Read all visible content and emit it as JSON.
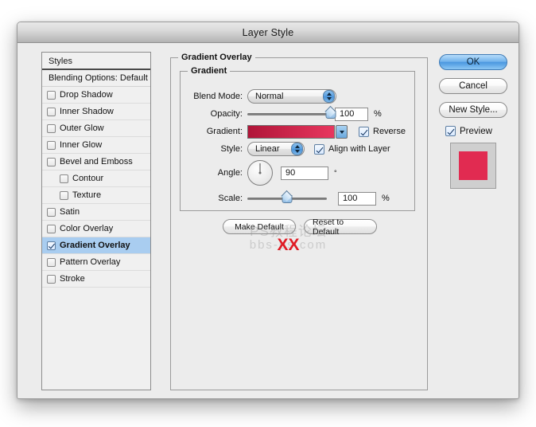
{
  "window": {
    "title": "Layer Style"
  },
  "styles_panel": {
    "header": "Styles",
    "blending_options": "Blending Options: Default",
    "items": [
      {
        "label": "Drop Shadow",
        "checked": false,
        "indent": false,
        "selected": false
      },
      {
        "label": "Inner Shadow",
        "checked": false,
        "indent": false,
        "selected": false
      },
      {
        "label": "Outer Glow",
        "checked": false,
        "indent": false,
        "selected": false
      },
      {
        "label": "Inner Glow",
        "checked": false,
        "indent": false,
        "selected": false
      },
      {
        "label": "Bevel and Emboss",
        "checked": false,
        "indent": false,
        "selected": false
      },
      {
        "label": "Contour",
        "checked": false,
        "indent": true,
        "selected": false
      },
      {
        "label": "Texture",
        "checked": false,
        "indent": true,
        "selected": false
      },
      {
        "label": "Satin",
        "checked": false,
        "indent": false,
        "selected": false
      },
      {
        "label": "Color Overlay",
        "checked": false,
        "indent": false,
        "selected": false
      },
      {
        "label": "Gradient Overlay",
        "checked": true,
        "indent": false,
        "selected": true
      },
      {
        "label": "Pattern Overlay",
        "checked": false,
        "indent": false,
        "selected": false
      },
      {
        "label": "Stroke",
        "checked": false,
        "indent": false,
        "selected": false
      }
    ]
  },
  "main": {
    "group_title": "Gradient Overlay",
    "gradient_group_title": "Gradient",
    "blend_mode": {
      "label": "Blend Mode:",
      "value": "Normal"
    },
    "opacity": {
      "label": "Opacity:",
      "value": "100",
      "unit": "%",
      "percent": 100
    },
    "gradient": {
      "label": "Gradient:",
      "stop_start": "#b01538",
      "stop_end": "#e8375f",
      "reverse_label": "Reverse",
      "reverse_checked": true
    },
    "style": {
      "label": "Style:",
      "value": "Linear",
      "align_label": "Align with Layer",
      "align_checked": true
    },
    "angle": {
      "label": "Angle:",
      "value": "90",
      "unit": "°",
      "degrees": 90
    },
    "scale": {
      "label": "Scale:",
      "value": "100",
      "unit": "%",
      "percent": 50
    },
    "make_default": "Make Default",
    "reset_to_default": "Reset to Default"
  },
  "right": {
    "ok": "OK",
    "cancel": "Cancel",
    "new_style": "New Style...",
    "preview_label": "Preview",
    "preview_checked": true,
    "preview_color": "#e12b51"
  },
  "watermark": {
    "line1": "PS教程论坛",
    "line2": "bbs-ps.com",
    "mark": "XX"
  }
}
